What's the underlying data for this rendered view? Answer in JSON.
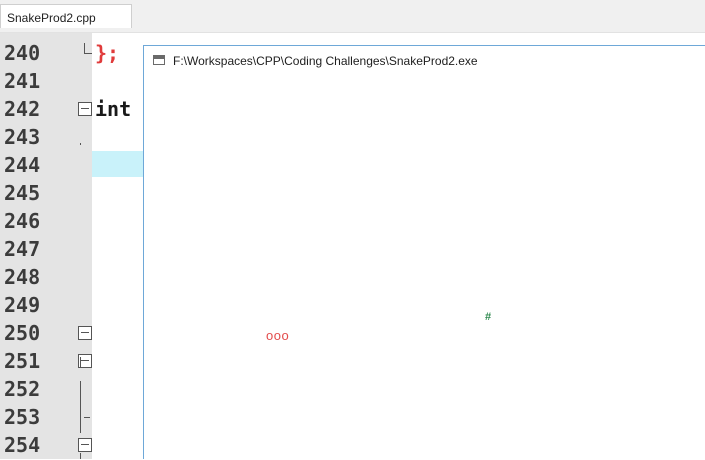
{
  "editor": {
    "tab_label": "SnakeProd2.cpp",
    "code_brace": "};",
    "code_keyword": "int"
  },
  "gutter": {
    "line_numbers": [
      "240",
      "241",
      "242",
      "243",
      "244",
      "245",
      "246",
      "247",
      "248",
      "249",
      "250",
      "251",
      "252",
      "253",
      "254"
    ]
  },
  "console": {
    "title": "F:\\Workspaces\\CPP\\Coding Challenges\\SnakeProd2.exe",
    "snake_text": "ooo",
    "food_text": "#"
  },
  "colors": {
    "snake": "#e34c4c",
    "food": "#2f8a4f",
    "current_line_highlight": "#c9f2fa",
    "console_border": "#6ea8d8"
  }
}
